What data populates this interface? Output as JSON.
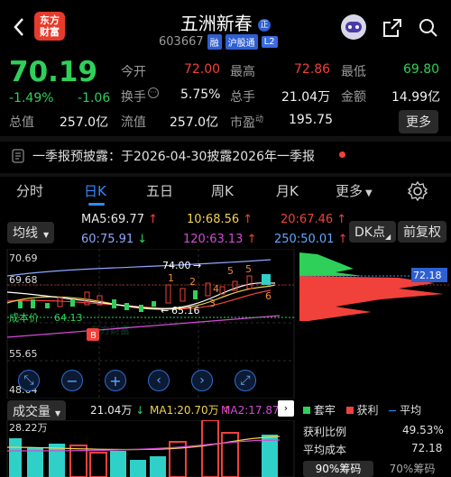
{
  "header": {
    "logo_text_1": "东方",
    "logo_text_2": "财富",
    "title": "五洲新春",
    "title_badge": "正",
    "code": "603667",
    "tags": [
      "融",
      "沪股通",
      "L2"
    ]
  },
  "quote": {
    "price": "70.19",
    "change_pct": "-1.49%",
    "change_amt": "-1.06",
    "open_label": "今开",
    "open": "72.00",
    "high_label": "最高",
    "high": "72.86",
    "low_label": "最低",
    "low": "69.80",
    "turnover_label": "换手",
    "turnover": "5.75%",
    "volume_label": "总手",
    "volume": "21.04万",
    "amount_label": "金额",
    "amount": "14.99亿",
    "total_mv_label": "总值",
    "total_mv": "257.0亿",
    "float_mv_label": "流值",
    "float_mv": "257.0亿",
    "pe_label": "市盈",
    "pe_sub": "动",
    "pe": "195.75",
    "more_label": "更多"
  },
  "notice": {
    "text": "一季报预披露：于2026-04-30披露2026年一季报"
  },
  "tabs": [
    "分时",
    "日K",
    "五日",
    "周K",
    "月K",
    "更多"
  ],
  "active_tab": "日K",
  "ma_bar": {
    "selector": "均线",
    "ma5": "MA5:69.77",
    "ma10": "10:68.56",
    "ma20": "20:67.46",
    "ma60": "60:75.91",
    "ma120": "120:63.13",
    "ma250": "250:50.01",
    "dk_label": "DK点",
    "adj_label": "前复权"
  },
  "chart": {
    "y_top": "70.69",
    "y_mid1": "69.68",
    "y_low_label": "成本价",
    "y_low": "64.13",
    "y_mid2": "55.65",
    "y_bottom": "48.64",
    "annot_high": "74.00",
    "annot_low": "65.16",
    "right_price": "72.18",
    "markers": [
      "1",
      "2",
      "3",
      "4",
      "5",
      "6"
    ],
    "b_marker": "B",
    "watermark": "东方财富"
  },
  "volume": {
    "selector": "成交量",
    "max": "28.22万",
    "vol": "21.04万",
    "ma1": "MA1:20.70万",
    "ma2": "MA2:17.87万"
  },
  "chips": {
    "legend": [
      "套牢",
      "获利",
      "平均"
    ],
    "profit_label": "获利比例",
    "profit_value": "49.53%",
    "avg_label": "平均成本",
    "avg_value": "72.18",
    "tab_90": "90%筹码",
    "tab_70": "70%筹码"
  },
  "colors": {
    "up": "#f0423a",
    "down": "#2fd05a",
    "accent": "#2f8cff"
  }
}
